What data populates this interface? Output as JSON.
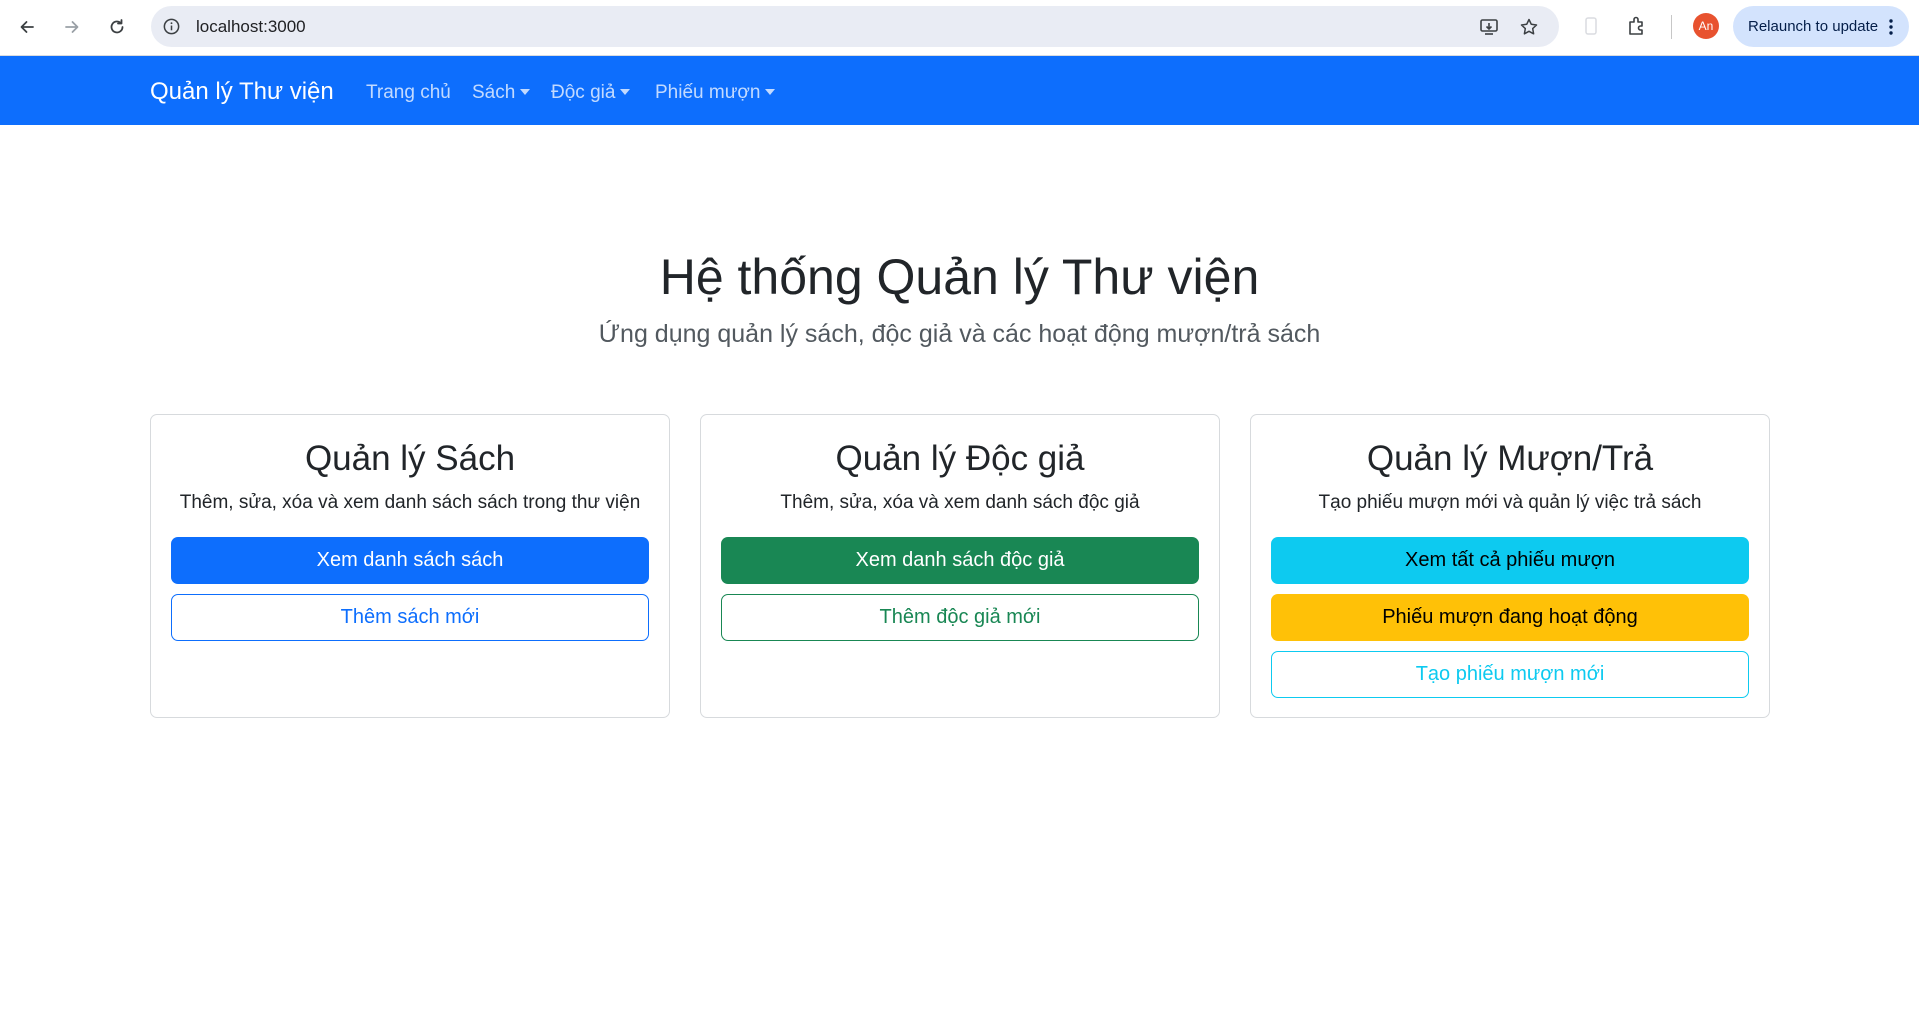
{
  "browser": {
    "url": "localhost:3000",
    "avatar_initials": "An",
    "relaunch_label": "Relaunch to update"
  },
  "navbar": {
    "brand": "Quản lý Thư viện",
    "items": [
      {
        "label": "Trang chủ"
      },
      {
        "label": "Sách"
      },
      {
        "label": "Độc giả"
      },
      {
        "label": "Phiếu mượn"
      }
    ]
  },
  "hero": {
    "title": "Hệ thống Quản lý Thư viện",
    "subtitle": "Ứng dụng quản lý sách, độc giả và các hoạt động mượn/trả sách"
  },
  "cards": [
    {
      "title": "Quản lý Sách",
      "text": "Thêm, sửa, xóa và xem danh sách sách trong thư viện",
      "buttons": [
        "Xem danh sách sách",
        "Thêm sách mới"
      ]
    },
    {
      "title": "Quản lý Độc giả",
      "text": "Thêm, sửa, xóa và xem danh sách độc giả",
      "buttons": [
        "Xem danh sách độc giả",
        "Thêm độc giả mới"
      ]
    },
    {
      "title": "Quản lý Mượn/Trả",
      "text": "Tạo phiếu mượn mới và quản lý việc trả sách",
      "buttons": [
        "Xem tất cả phiếu mượn",
        "Phiếu mượn đang hoạt động",
        "Tạo phiếu mượn mới"
      ]
    }
  ],
  "colors": {
    "primary": "#0d6efd",
    "success": "#198754",
    "info": "#0dcaf0",
    "warning": "#ffc107"
  }
}
